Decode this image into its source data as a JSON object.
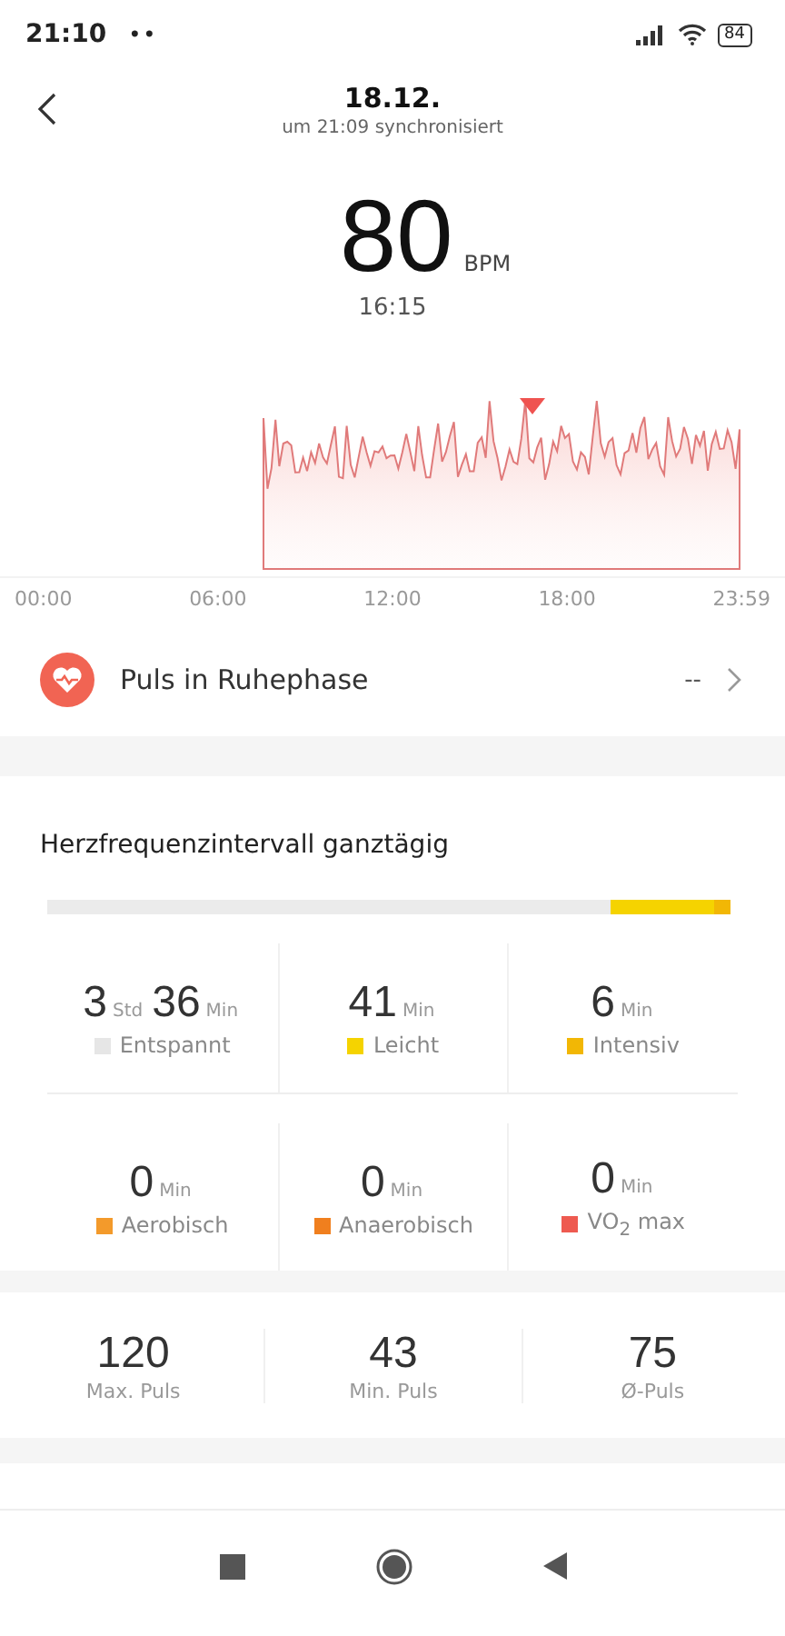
{
  "status_bar": {
    "time": "21:10",
    "dots": "••",
    "battery": "84"
  },
  "header": {
    "title": "18.12.",
    "subtitle": "um 21:09 synchronisiert"
  },
  "heart_rate": {
    "value": "80",
    "unit": "BPM",
    "time": "16:15"
  },
  "chart": {
    "x_labels": [
      "00:00",
      "06:00",
      "12:00",
      "18:00",
      "23:59"
    ]
  },
  "resting": {
    "label": "Puls in Ruhephase",
    "value": "--"
  },
  "intervals": {
    "title": "Herzfrequenzintervall ganztägig",
    "bar": [
      {
        "color": "#ebebeb"
      },
      {
        "color": "#f5d300"
      },
      {
        "color": "#f2b705"
      }
    ],
    "zones": [
      {
        "parts": [
          {
            "kind": "number",
            "text": "3"
          },
          {
            "kind": "unit",
            "text": "Std"
          },
          {
            "kind": "number",
            "text": "36"
          },
          {
            "kind": "unit",
            "text": "Min"
          }
        ],
        "label": "Entspannt",
        "color": "#e6e6e6"
      },
      {
        "parts": [
          {
            "kind": "number",
            "text": "41"
          },
          {
            "kind": "unit",
            "text": "Min"
          }
        ],
        "label": "Leicht",
        "color": "#f5d300"
      },
      {
        "parts": [
          {
            "kind": "number",
            "text": "6"
          },
          {
            "kind": "unit",
            "text": "Min"
          }
        ],
        "label": "Intensiv",
        "color": "#f2b705"
      },
      {
        "parts": [
          {
            "kind": "number",
            "text": "0"
          },
          {
            "kind": "unit",
            "text": "Min"
          }
        ],
        "label": "Aerobisch",
        "color": "#f39a2b"
      },
      {
        "parts": [
          {
            "kind": "number",
            "text": "0"
          },
          {
            "kind": "unit",
            "text": "Min"
          }
        ],
        "label": "Anaerobisch",
        "color": "#f07f1e"
      },
      {
        "parts": [
          {
            "kind": "number",
            "text": "0"
          },
          {
            "kind": "unit",
            "text": "Min"
          }
        ],
        "label": "VO$_{2}$ max",
        "color": "#ee5a50"
      }
    ]
  },
  "stats": [
    {
      "value": "120",
      "label": "Max. Puls"
    },
    {
      "value": "43",
      "label": "Min. Puls"
    },
    {
      "value": "75",
      "label": "Ø-Puls"
    }
  ]
}
